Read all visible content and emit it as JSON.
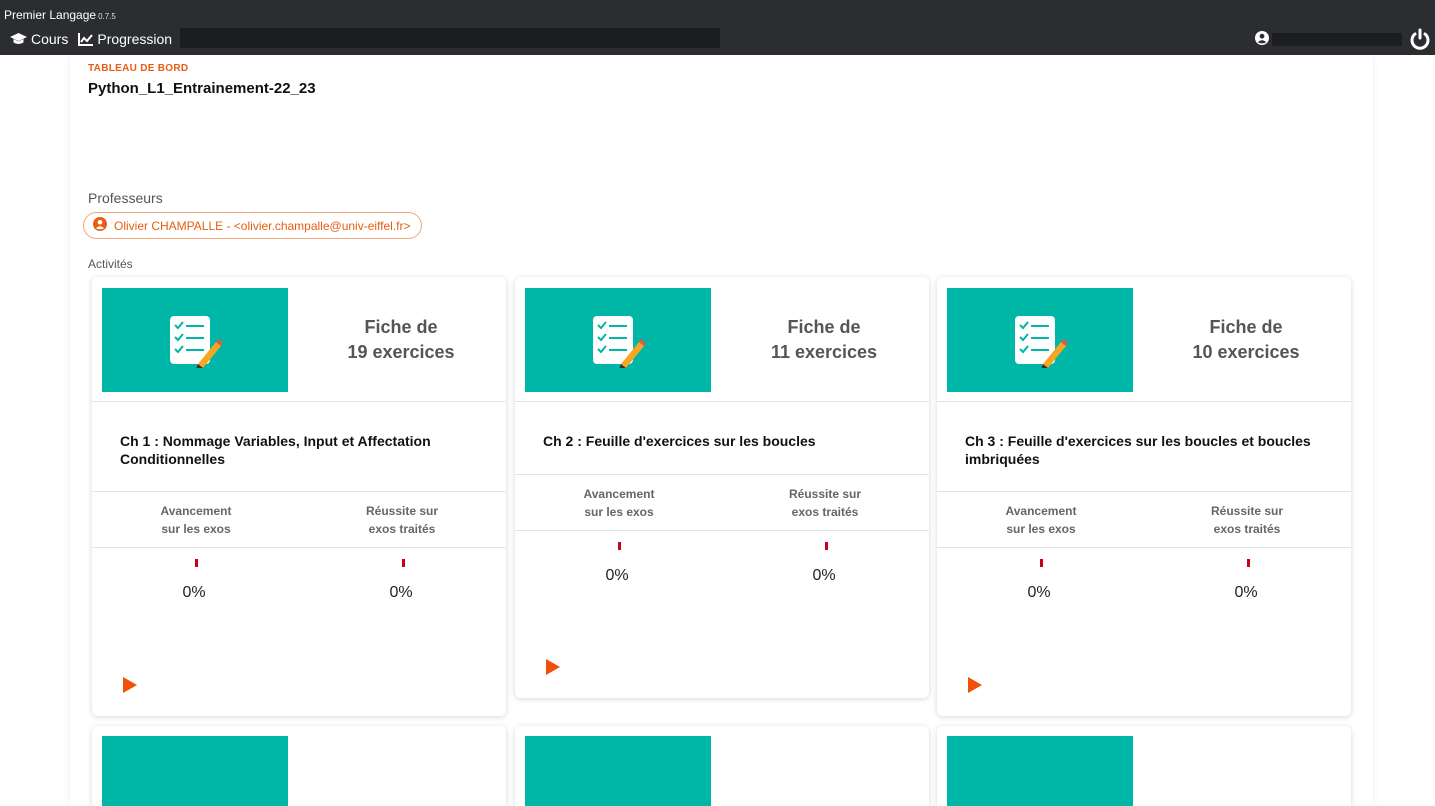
{
  "app": {
    "name": "Premier Langage",
    "version": "0.7.5"
  },
  "nav": {
    "cours": "Cours",
    "progression": "Progression"
  },
  "page": {
    "breadcrumb": "TABLEAU DE BORD",
    "title": "Python_L1_Entrainement-22_23",
    "professors_label": "Professeurs",
    "professor": "Olivier CHAMPALLE - <olivier.champalle@univ-eiffel.fr>",
    "activities_label": "Activités"
  },
  "stats_labels": {
    "avancement_1": "Avancement",
    "avancement_2": "sur les exos",
    "reussite_1": "Réussite sur",
    "reussite_2": "exos traités"
  },
  "cards": [
    {
      "sheet_1": "Fiche de",
      "sheet_2": "19 exercices",
      "title": "Ch 1 : Nommage Variables, Input et Affectation Conditionnelles",
      "avancement": "0%",
      "reussite": "0%"
    },
    {
      "sheet_1": "Fiche de",
      "sheet_2": "11 exercices",
      "title": "Ch 2 : Feuille d'exercices sur les boucles",
      "avancement": "0%",
      "reussite": "0%"
    },
    {
      "sheet_1": "Fiche de",
      "sheet_2": "10 exercices",
      "title": "Ch 3 : Feuille d'exercices sur les boucles et boucles imbriquées",
      "avancement": "0%",
      "reussite": "0%"
    }
  ],
  "colors": {
    "accent": "#e85d12",
    "thumb": "#00b6a6",
    "topbar": "#2b2d31",
    "tick": "#c8001e"
  }
}
